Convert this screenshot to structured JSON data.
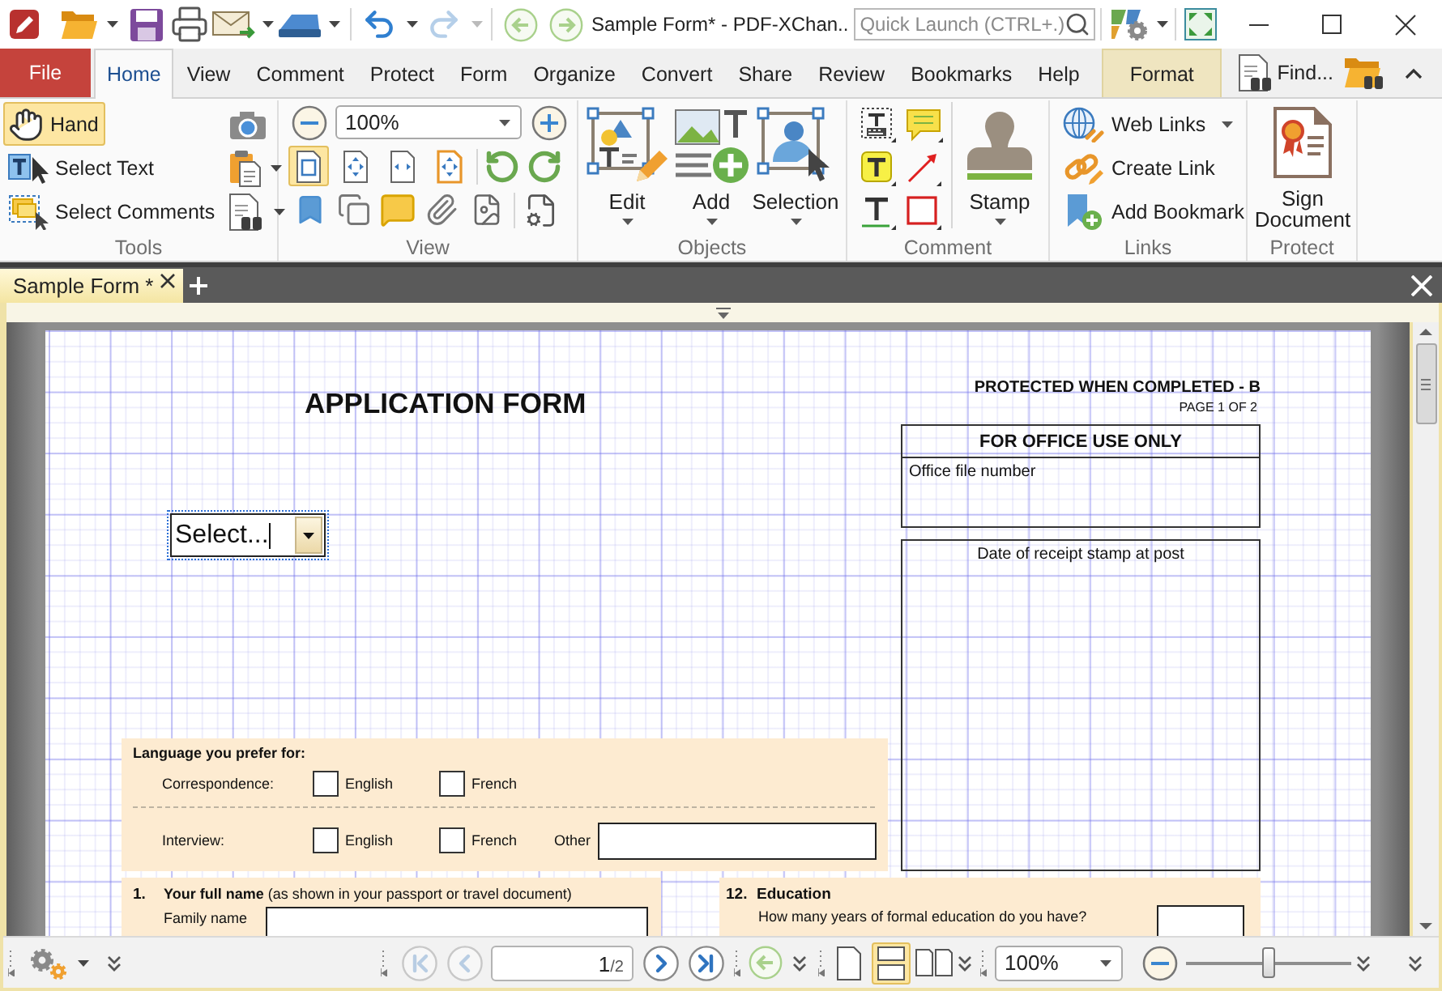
{
  "title_bar": {
    "title": "Sample Form* - PDF-XChan..",
    "quick_launch": {
      "placeholder": "Quick Launch (CTRL+.)"
    },
    "undo": {
      "disabled": false
    },
    "redo": {
      "disabled": true
    },
    "history_back": {
      "disabled": true
    },
    "history_forward": {
      "disabled": true
    }
  },
  "menu_tabs": [
    {
      "label": "File",
      "kind": "file",
      "selected": false
    },
    {
      "label": "Home",
      "kind": "tab",
      "selected": true
    },
    {
      "label": "View",
      "kind": "tab",
      "selected": false
    },
    {
      "label": "Comment",
      "kind": "tab",
      "selected": false
    },
    {
      "label": "Protect",
      "kind": "tab",
      "selected": false
    },
    {
      "label": "Form",
      "kind": "tab",
      "selected": false
    },
    {
      "label": "Organize",
      "kind": "tab",
      "selected": false
    },
    {
      "label": "Convert",
      "kind": "tab",
      "selected": false
    },
    {
      "label": "Share",
      "kind": "tab",
      "selected": false
    },
    {
      "label": "Review",
      "kind": "tab",
      "selected": false
    },
    {
      "label": "Bookmarks",
      "kind": "tab",
      "selected": false
    },
    {
      "label": "Help",
      "kind": "tab",
      "selected": false
    },
    {
      "label": "Format",
      "kind": "context",
      "selected": false
    }
  ],
  "find": {
    "label": "Find..."
  },
  "ribbon": {
    "tools": {
      "label": "Tools",
      "items": [
        {
          "label": "Hand",
          "selected": true
        },
        {
          "label": "Select Text",
          "selected": false
        },
        {
          "label": "Select Comments",
          "selected": false
        }
      ]
    },
    "view": {
      "label": "View",
      "zoom": {
        "value": "100%"
      },
      "page_fit_buttons": [
        {
          "selected": true
        },
        {
          "selected": false
        },
        {
          "selected": false
        },
        {
          "selected": false
        }
      ]
    },
    "objects": {
      "label": "Objects",
      "buttons": [
        {
          "label": "Edit"
        },
        {
          "label": "Add"
        },
        {
          "label": "Selection"
        }
      ]
    },
    "comment": {
      "label": "Comment",
      "stamp": {
        "label": "Stamp"
      }
    },
    "links": {
      "label": "Links",
      "buttons": [
        {
          "label": "Web Links"
        },
        {
          "label": "Create Link"
        },
        {
          "label": "Add Bookmark"
        }
      ]
    },
    "protect": {
      "label": "Protect",
      "sign": {
        "label": "Sign Document"
      }
    }
  },
  "document_tabs": [
    {
      "label": "Sample Form *",
      "selected": true
    }
  ],
  "page": {
    "title": "APPLICATION FORM",
    "protection": "PROTECTED WHEN COMPLETED - B",
    "page_number": "PAGE 1 OF 2",
    "office_box": {
      "heading": "FOR OFFICE USE ONLY",
      "label": "Office file number"
    },
    "stamp_box": {
      "label": "Date of receipt stamp at post"
    },
    "select_field": {
      "value": "Select..."
    },
    "language": {
      "heading": "Language you prefer for:",
      "rows": [
        {
          "label": "Correspondence:",
          "options": [
            {
              "label": "English",
              "checked": false
            },
            {
              "label": "French",
              "checked": false
            }
          ]
        },
        {
          "label": "Interview:",
          "options": [
            {
              "label": "English",
              "checked": false
            },
            {
              "label": "French",
              "checked": false
            }
          ],
          "other": {
            "label": "Other"
          }
        }
      ]
    },
    "full_name": {
      "number": "1.",
      "heading": "**Your full name** (as shown in your passport or travel document)",
      "field_label": "Family name"
    },
    "education": {
      "number": "12.",
      "heading": "Education",
      "question": "How many years of formal education do you have?"
    }
  },
  "status_bar": {
    "nav": [
      {
        "kind": "first",
        "disabled": true
      },
      {
        "kind": "previous",
        "disabled": true
      },
      {
        "kind": "next",
        "disabled": false
      },
      {
        "kind": "last",
        "disabled": false
      }
    ],
    "page_field": {
      "value": "1",
      "total": "/2"
    },
    "back": {
      "disabled": true
    },
    "layouts": [
      {
        "selected": false
      },
      {
        "selected": true
      },
      {
        "selected": false
      }
    ],
    "zoom_field": {
      "value": "100%"
    },
    "zoom_slider": {
      "level": 0.5
    }
  }
}
